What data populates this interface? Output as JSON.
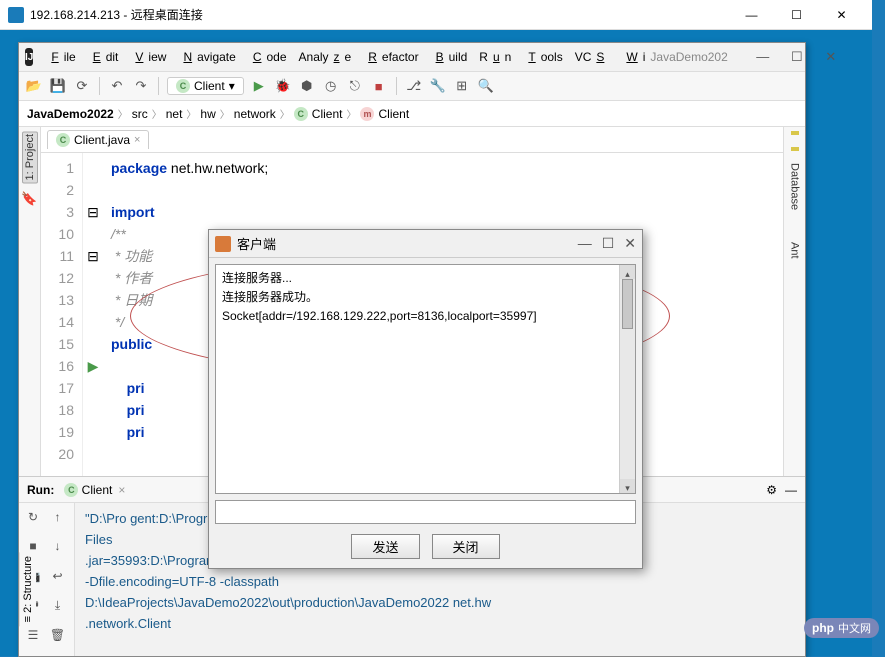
{
  "rdp": {
    "title": "192.168.214.213 - 远程桌面连接"
  },
  "ide": {
    "title": "JavaDemo202",
    "menu": [
      "File",
      "Edit",
      "View",
      "Navigate",
      "Code",
      "Analyze",
      "Refactor",
      "Build",
      "Run",
      "Tools",
      "VCS",
      "Wi"
    ],
    "run_config": "Client",
    "breadcrumb": [
      "JavaDemo2022",
      "src",
      "net",
      "hw",
      "network",
      "Client",
      "Client"
    ],
    "tab": "Client.java",
    "left_tool": "1: Project",
    "right_tools": [
      "Database",
      "Ant"
    ],
    "left_bottom": "2: Structure"
  },
  "code": {
    "lines": [
      "1",
      "2",
      "3",
      "10",
      "11",
      "12",
      "13",
      "14",
      "15",
      "16",
      "17",
      "18",
      "19",
      "20"
    ],
    "l1": "package net.hw.network;",
    "l3": "import ",
    "l11": "/**",
    "l12": " * 功能",
    "l13": " * 作者",
    "l14": " * 日期",
    "l15": " */",
    "l16": "public ",
    "l18": "    pri",
    "l19": "    pri",
    "l20": "    pri"
  },
  "run": {
    "label": "Run:",
    "tab": "Client",
    "out1": "\"D:\\Pro                                                  gent:D:\\Program",
    "out2": " Files",
    "out3": ".jar=35993:D:\\Program Files\\JetBrains\\IntelliJ IDEA 2020.1\\bin\"",
    "out4": "-Dfile.encoding=UTF-8 -classpath",
    "out5": "D:\\IdeaProjects\\JavaDemo2022\\out\\production\\JavaDemo2022 net.hw",
    "out6": ".network.Client"
  },
  "dialog": {
    "title": "客户端",
    "line1": "连接服务器...",
    "line2": "连接服务器成功。",
    "line3": "Socket[addr=/192.168.129.222,port=8136,localport=35997]",
    "btn_send": "发送",
    "btn_close": "关闭"
  },
  "logo": {
    "php": "php",
    "cn": "中文网"
  }
}
